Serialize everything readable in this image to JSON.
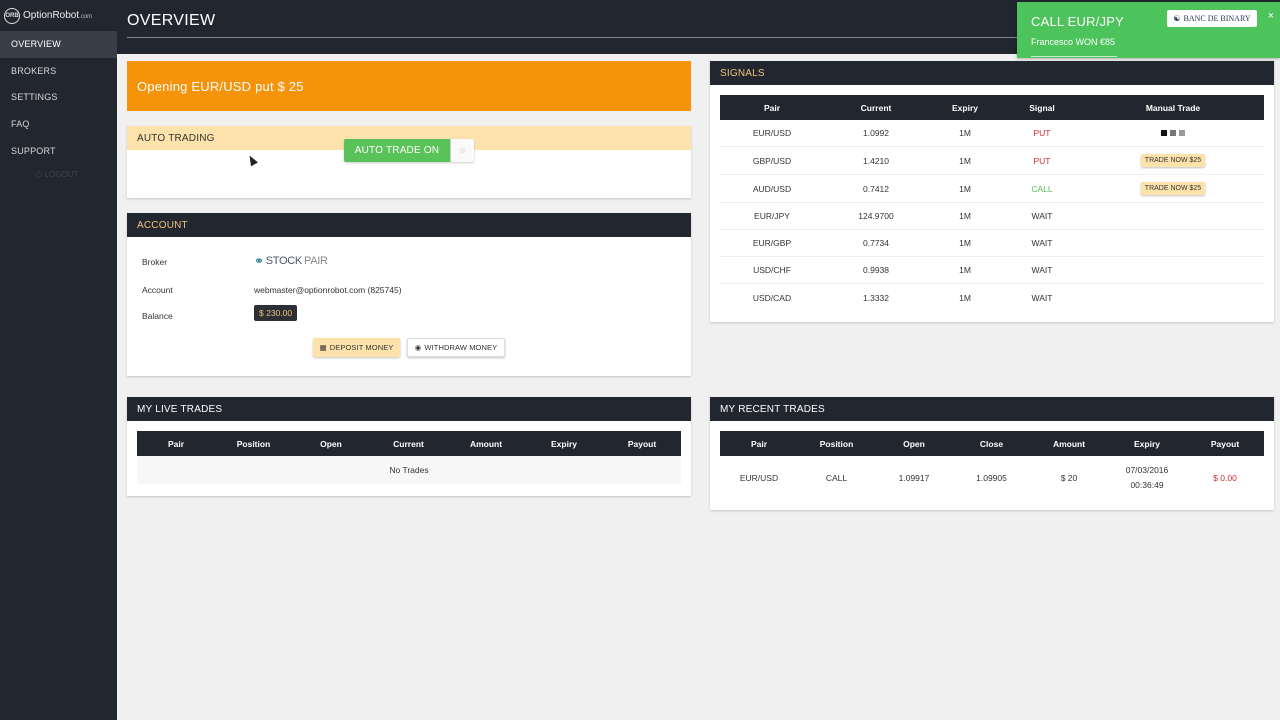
{
  "brand": {
    "logo_mark": "ORB",
    "name": "OptionRobot",
    "suffix": ".com"
  },
  "sidebar": {
    "items": [
      {
        "label": "OVERVIEW"
      },
      {
        "label": "BROKERS"
      },
      {
        "label": "SETTINGS"
      },
      {
        "label": "FAQ"
      },
      {
        "label": "SUPPORT"
      }
    ],
    "logout": "LOGOUT"
  },
  "header": {
    "title": "OVERVIEW"
  },
  "toast": {
    "title": "CALL EUR/JPY",
    "message": "Francesco WON €85",
    "brand": "BANC DE BINARY",
    "close": "×"
  },
  "alert": {
    "text": "Opening EUR/USD put $ 25"
  },
  "auto_trading": {
    "title": "AUTO TRADING",
    "toggle_label": "AUTO TRADE ON"
  },
  "account": {
    "title": "ACCOUNT",
    "broker_label": "Broker",
    "broker_logo": {
      "stock": "STOCK",
      "pair": "PAIR"
    },
    "account_label": "Account",
    "account_value": "webmaster@optionrobot.com (825745)",
    "balance_label": "Balance",
    "balance_value": "$ 230.00",
    "deposit_label": "DEPOSIT MONEY",
    "withdraw_label": "WITHDRAW MONEY"
  },
  "signals": {
    "title": "SIGNALS",
    "columns": [
      "Pair",
      "Current",
      "Expiry",
      "Signal",
      "Manual Trade"
    ],
    "rows": [
      {
        "pair": "EUR/USD",
        "current": "1.0992",
        "expiry": "1M",
        "signal": "PUT",
        "action": "dots"
      },
      {
        "pair": "GBP/USD",
        "current": "1.4210",
        "expiry": "1M",
        "signal": "PUT",
        "action": "TRADE NOW $25"
      },
      {
        "pair": "AUD/USD",
        "current": "0.7412",
        "expiry": "1M",
        "signal": "CALL",
        "action": "TRADE NOW $25"
      },
      {
        "pair": "EUR/JPY",
        "current": "124.9700",
        "expiry": "1M",
        "signal": "WAIT",
        "action": ""
      },
      {
        "pair": "EUR/GBP",
        "current": "0.7734",
        "expiry": "1M",
        "signal": "WAIT",
        "action": ""
      },
      {
        "pair": "USD/CHF",
        "current": "0.9938",
        "expiry": "1M",
        "signal": "WAIT",
        "action": ""
      },
      {
        "pair": "USD/CAD",
        "current": "1.3332",
        "expiry": "1M",
        "signal": "WAIT",
        "action": ""
      }
    ]
  },
  "live_trades": {
    "title": "MY LIVE TRADES",
    "columns": [
      "Pair",
      "Position",
      "Open",
      "Current",
      "Amount",
      "Expiry",
      "Payout"
    ],
    "empty": "No Trades"
  },
  "recent_trades": {
    "title": "MY RECENT TRADES",
    "columns": [
      "Pair",
      "Position",
      "Open",
      "Close",
      "Amount",
      "Expiry",
      "Payout"
    ],
    "rows": [
      {
        "pair": "EUR/USD",
        "position": "CALL",
        "open": "1.09917",
        "close": "1.09905",
        "amount": "$ 20",
        "expiry_date": "07/03/2016",
        "expiry_time": "00:36:49",
        "payout": "$ 0.00"
      }
    ]
  },
  "colors": {
    "sidebar": "#22262f",
    "alert": "#f5930a",
    "toggle": "#59c35a",
    "toast": "#4cc35b",
    "accent": "#f0c27a",
    "put": "#c9302c",
    "call": "#5cb85c"
  }
}
